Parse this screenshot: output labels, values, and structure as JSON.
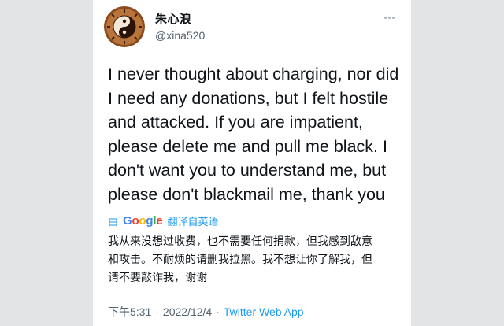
{
  "tweet": {
    "author": {
      "display_name": "朱心浪",
      "handle": "@xina520",
      "avatar_icon": "yin-yang-bagua-icon"
    },
    "more_icon": "more-horizontal-icon",
    "text_lines": [
      "I never thought about charging, nor did",
      "I need any donations, but I felt hostile",
      "and attacked. If you are impatient,",
      "please delete me and pull me black. I",
      "don't want you to understand me, but",
      "please don't blackmail me, thank you"
    ],
    "translation": {
      "by_label": "由",
      "provider_letters": [
        "G",
        "o",
        "o",
        "g",
        "l",
        "e"
      ],
      "action_label": "翻译自英语",
      "lines": [
        "我从来没想过收费，也不需要任何捐款，但我感到敌意",
        "和攻击。不耐烦的请删我拉黑。我不想让你了解我，但",
        "请不要敲诈我，谢谢"
      ]
    },
    "meta": {
      "time": "下午5:31",
      "separator": "·",
      "date": "2022/12/4",
      "source": "Twitter Web App"
    }
  },
  "colors": {
    "text": "#0f1419",
    "secondary": "#536471",
    "link": "#1d9bf0",
    "background": "#e3e4e6"
  }
}
